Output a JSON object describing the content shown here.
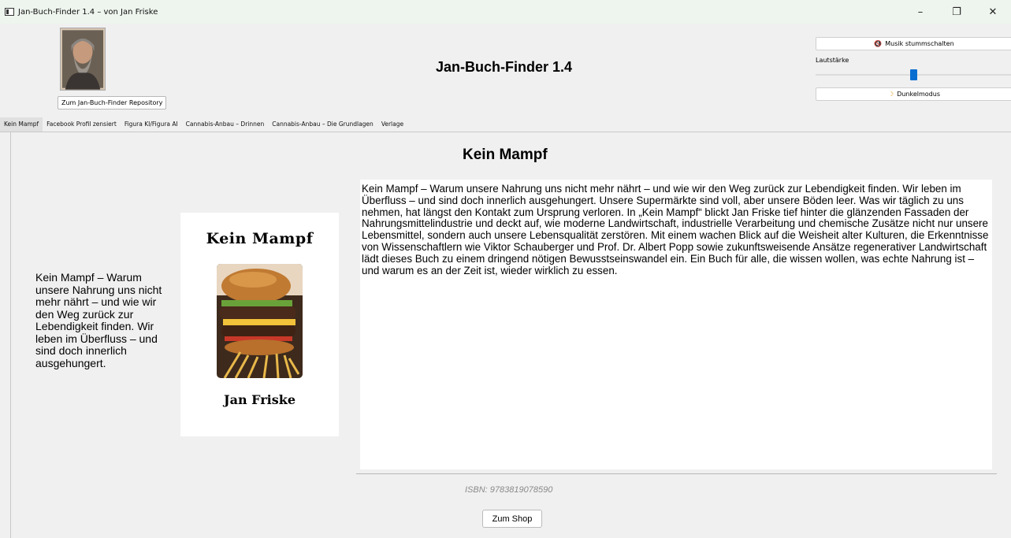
{
  "window": {
    "title": "Jan-Buch-Finder 1.4 – von Jan Friske",
    "controls": {
      "minimize": "–",
      "restore": "❐",
      "close": "✕"
    }
  },
  "header": {
    "heading": "Jan-Buch-Finder 1.4",
    "repo_button": "Zum Jan-Buch-Finder Repository",
    "mute_button": "Musik stummschalten",
    "volume_label": "Lautstärke",
    "volume_level": 0.5,
    "dark_mode_button": "Dunkelmodus",
    "accent_color": "#0a6ed1"
  },
  "tabs": [
    {
      "label": "Kein Mampf",
      "active": true
    },
    {
      "label": "Facebook Profil zensiert",
      "active": false
    },
    {
      "label": "Figura KI/Figura AI",
      "active": false
    },
    {
      "label": "Cannabis-Anbau – Drinnen",
      "active": false
    },
    {
      "label": "Cannabis-Anbau – Die Grundlagen",
      "active": false
    },
    {
      "label": "Verlage",
      "active": false
    }
  ],
  "book": {
    "title": "Kein Mampf",
    "short_description": "Kein Mampf – Warum unsere Nahrung uns nicht mehr nährt – und wie wir den Weg zurück zur Lebendigkeit finden. Wir leben im Überfluss – und sind doch innerlich ausgehungert.",
    "cover_title": "Kein Mampf",
    "cover_author": "Jan Friske",
    "long_description": "Kein Mampf – Warum unsere Nahrung uns nicht mehr nährt – und wie wir den Weg zurück zur Lebendigkeit finden. Wir leben im Überfluss – und sind doch innerlich ausgehungert. Unsere Supermärkte sind voll, aber unsere Böden leer. Was wir täglich zu uns nehmen, hat längst den Kontakt zum Ursprung verloren. In „Kein Mampf“ blickt Jan Friske tief hinter die glänzenden Fassaden der Nahrungsmittelindustrie und deckt auf, wie moderne Landwirtschaft, industrielle Verarbeitung und chemische Zusätze nicht nur unsere Lebensmittel, sondern auch unsere Lebensqualität zerstören. Mit einem wachen Blick auf die Weisheit alter Kulturen, die Erkenntnisse von Wissenschaftlern wie Viktor Schauberger und Prof. Dr. Albert Popp sowie zukunftsweisende Ansätze regenerativer Landwirtschaft lädt dieses Buch zu einem dringend nötigen Bewusstseinswandel ein. Ein Buch für alle, die wissen wollen, was echte Nahrung ist – und warum es an der Zeit ist, wieder wirklich zu essen.",
    "isbn": "ISBN: 9783819078590",
    "shop_button": "Zum Shop"
  },
  "icons": {
    "mute": "speaker-muted-icon",
    "dark_mode": "moon-icon",
    "app": "window-app-icon"
  }
}
